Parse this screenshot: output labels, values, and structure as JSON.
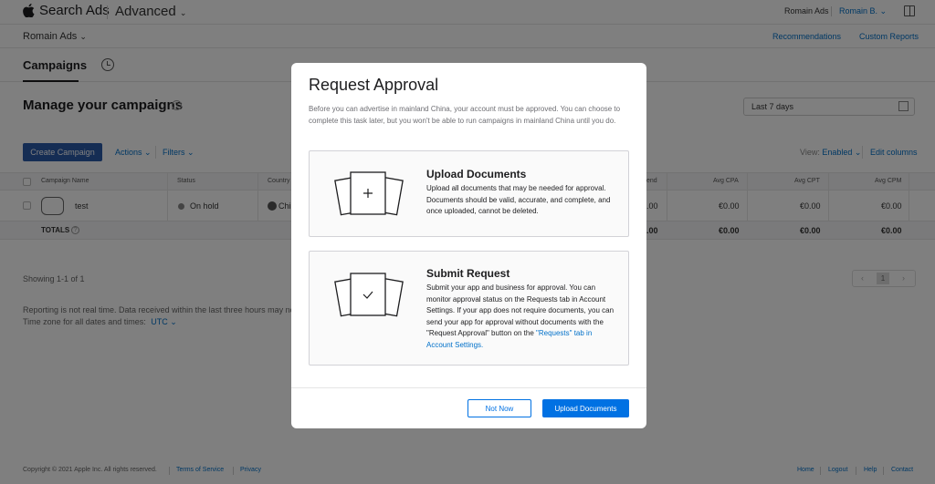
{
  "header": {
    "brand": "Search Ads",
    "advanced": "Advanced",
    "user": "Romain Ads",
    "user_menu": "Romain B."
  },
  "subheader": {
    "account": "Romain Ads",
    "recommendations": "Recommendations",
    "custom_reports": "Custom Reports"
  },
  "tabs": {
    "campaigns": "Campaigns"
  },
  "main": {
    "title": "Manage your campaigns",
    "date_range": "Last 7 days",
    "create_campaign": "Create Campaign",
    "actions": "Actions",
    "filters": "Filters",
    "view_label": "View:",
    "view_value": "Enabled",
    "edit_columns": "Edit columns"
  },
  "table": {
    "columns": {
      "campaign_name": "Campaign Name",
      "status": "Status",
      "country": "Country",
      "spend": "end",
      "avg_cpa": "Avg CPA",
      "avg_cpt": "Avg CPT",
      "avg_cpm": "Avg CPM"
    },
    "row": {
      "name": "test",
      "status": "On hold",
      "country": "Chi",
      "spend": ".00",
      "avg_cpa": "€0.00",
      "avg_cpt": "€0.00",
      "avg_cpm": "€0.00"
    },
    "totals": {
      "label": "TOTALS",
      "spend": ".00",
      "avg_cpa": "€0.00",
      "avg_cpt": "€0.00",
      "avg_cpm": "€0.00"
    }
  },
  "pagination": {
    "showing": "Showing 1-1 of 1",
    "current": "1"
  },
  "notes": {
    "line1": "Reporting is not real time. Data received within the last three hours may not be",
    "line2": "Time zone for all dates and times:",
    "timezone": "UTC"
  },
  "footer": {
    "copyright": "Copyright © 2021 Apple Inc. All rights reserved.",
    "terms": "Terms of Service",
    "privacy": "Privacy",
    "home": "Home",
    "logout": "Logout",
    "help": "Help",
    "contact": "Contact"
  },
  "modal": {
    "title": "Request Approval",
    "description": "Before you can advertise in mainland China, your account must be approved. You can choose to complete this task later, but you won't be able to run campaigns in mainland China until you do.",
    "upload": {
      "title": "Upload Documents",
      "text": "Upload all documents that may be needed for approval. Documents should be valid, accurate, and complete, and once uploaded, cannot be deleted."
    },
    "submit": {
      "title": "Submit Request",
      "text": "Submit your app and business for approval. You can monitor approval status on the Requests tab in Account Settings. If your app does not require documents, you can send your app for approval without documents with the \"Request Approval\" button on the",
      "link": "\"Requests\" tab in Account Settings."
    },
    "not_now": "Not Now",
    "upload_button": "Upload Documents"
  },
  "colors": {
    "accent": "#0071e3",
    "create_button": "#2a5aa8"
  },
  "icons": [
    "apple-icon",
    "chevron-down-icon",
    "sidebar-icon",
    "history-icon",
    "help-icon",
    "calendar-icon",
    "documents-plus-icon",
    "documents-check-icon"
  ]
}
